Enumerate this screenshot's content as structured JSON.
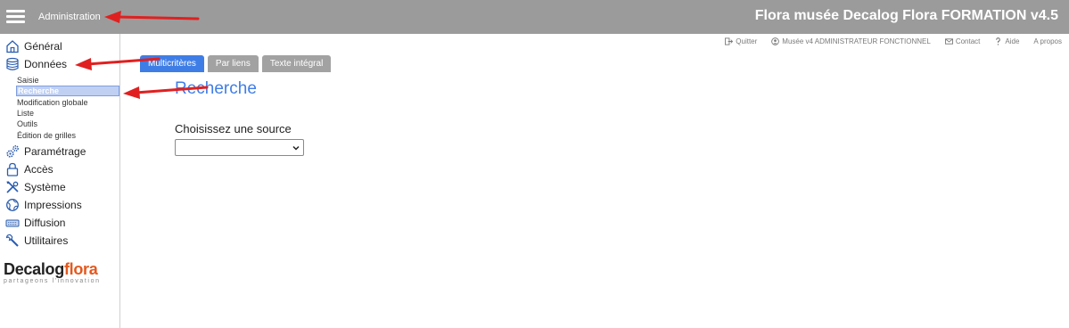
{
  "header": {
    "menu_label": "Administration",
    "app_title": "Flora musée Decalog Flora FORMATION v4.5"
  },
  "utilbar": {
    "quit": "Quitter",
    "user": "Musée v4 ADMINISTRATEUR FONCTIONNEL",
    "contact": "Contact",
    "help": "Aide",
    "about": "A propos"
  },
  "sidebar": {
    "items": [
      {
        "label": "Général",
        "icon": "home-icon"
      },
      {
        "label": "Données",
        "icon": "database-icon"
      },
      {
        "label": "Paramétrage",
        "icon": "gears-icon"
      },
      {
        "label": "Accès",
        "icon": "lock-icon"
      },
      {
        "label": "Système",
        "icon": "tools-icon"
      },
      {
        "label": "Impressions",
        "icon": "globe-icon"
      },
      {
        "label": "Diffusion",
        "icon": "keyboard-icon"
      },
      {
        "label": "Utilitaires",
        "icon": "wrench-icon"
      }
    ],
    "subitems": [
      "Saisie",
      "Recherche",
      "Modification globale",
      "Liste",
      "Outils",
      "Édition de grilles"
    ],
    "active_subitem": "Recherche"
  },
  "logo": {
    "main_part1": "Decalog",
    "main_part2": "flora",
    "tagline": "partageons l'innovation"
  },
  "tabs": [
    {
      "label": "Multicritères",
      "active": true
    },
    {
      "label": "Par liens",
      "active": false
    },
    {
      "label": "Texte intégral",
      "active": false
    }
  ],
  "main": {
    "title": "Recherche",
    "source_label": "Choisissez une source",
    "source_value": ""
  },
  "colors": {
    "topbar": "#9b9b9b",
    "accent_blue": "#3f7de6",
    "logo_orange": "#e4581d",
    "annotation_red": "#e02020"
  }
}
